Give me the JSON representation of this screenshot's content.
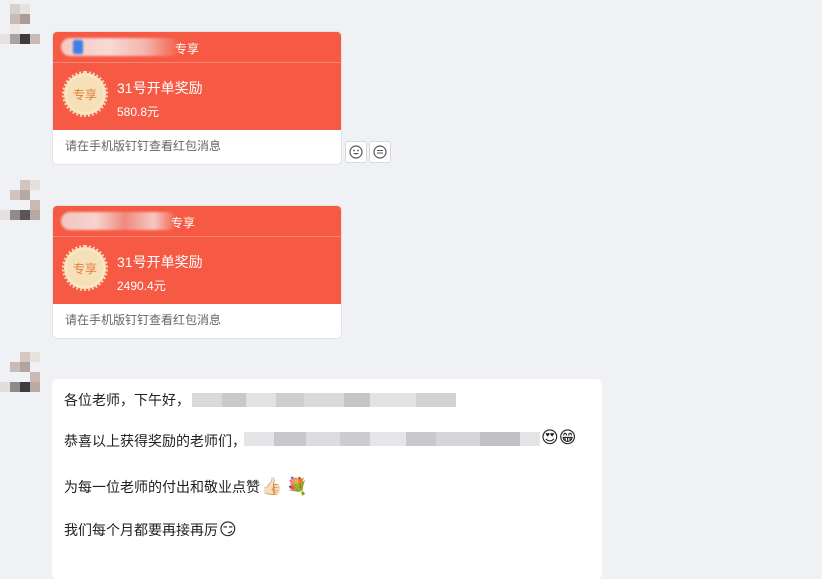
{
  "cards": [
    {
      "exclusive": "专享",
      "badge": "专享",
      "title": "31号开单奖励",
      "amount": "580.8元",
      "footer": "请在手机版钉钉查看红包消息"
    },
    {
      "exclusive": "专享",
      "badge": "专享",
      "title": "31号开单奖励",
      "amount": "2490.4元",
      "footer": "请在手机版钉钉查看红包消息"
    }
  ],
  "reactions": {
    "emoji_icon": "smiley-icon",
    "comment_icon": "comment-icon"
  },
  "message": {
    "line1": "各位老师，下午好，",
    "line2": "恭喜以上获得奖励的老师们，",
    "line2_emojis": "😍😁",
    "line3": "为每一位老师的付出和敬业点赞",
    "line3_emojis": "👍🏻 💐",
    "line4": "我们每个月都要再接再厉",
    "line4_emoji": "😏"
  }
}
